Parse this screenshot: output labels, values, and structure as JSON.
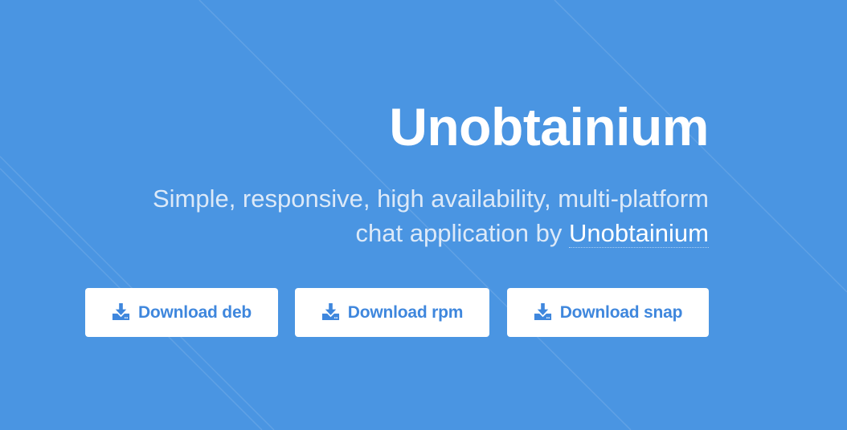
{
  "hero": {
    "title": "Unobtainium",
    "subtitle_line1": "Simple, responsive, high availability, multi-platform",
    "subtitle_line2_prefix": "chat application by ",
    "subtitle_link": "Unobtainium"
  },
  "buttons": {
    "deb": {
      "label": "Download deb",
      "icon": "download-icon"
    },
    "rpm": {
      "label": "Download rpm",
      "icon": "download-icon"
    },
    "snap": {
      "label": "Download snap",
      "icon": "download-icon"
    }
  },
  "colors": {
    "background": "#4a95e2",
    "button_bg": "#ffffff",
    "button_text": "#3f87dd",
    "title": "#ffffff",
    "subtitle": "#dce9f8"
  }
}
